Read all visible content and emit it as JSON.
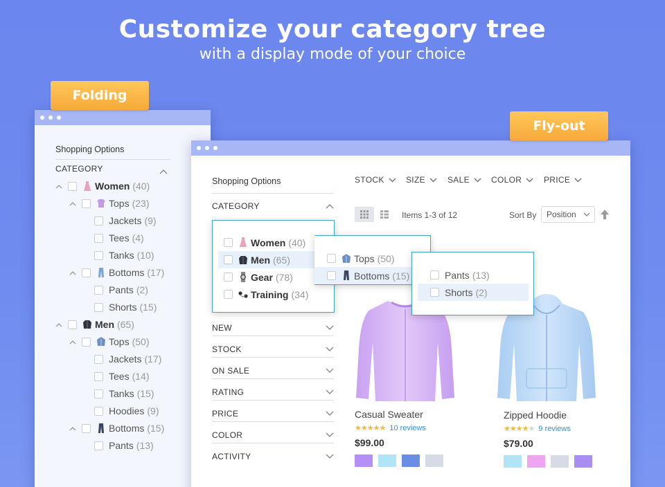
{
  "hero": {
    "title": "Customize your category tree",
    "subtitle": "with a display mode of your choice"
  },
  "badges": {
    "folding": "Folding",
    "flyout": "Fly-out"
  },
  "folding": {
    "header": "Shopping Options",
    "category_label": "CATEGORY",
    "tree": [
      {
        "label": "Women",
        "count": "(40)",
        "level": 0,
        "icon": "dress-icon",
        "bold": true
      },
      {
        "label": "Tops",
        "count": "(23)",
        "level": 1,
        "icon": "top-icon",
        "bold": false
      },
      {
        "label": "Jackets",
        "count": "(9)",
        "level": 2
      },
      {
        "label": "Tees",
        "count": "(4)",
        "level": 2
      },
      {
        "label": "Tanks",
        "count": "(10)",
        "level": 2
      },
      {
        "label": "Bottoms",
        "count": "(17)",
        "level": 1,
        "icon": "pants-icon"
      },
      {
        "label": "Pants",
        "count": "(2)",
        "level": 2
      },
      {
        "label": "Shorts",
        "count": "(15)",
        "level": 2
      },
      {
        "label": "Men",
        "count": "(65)",
        "level": 0,
        "icon": "jacket-icon",
        "bold": true
      },
      {
        "label": "Tops",
        "count": "(50)",
        "level": 1,
        "icon": "hoodie-icon"
      },
      {
        "label": "Jackets",
        "count": "(17)",
        "level": 2
      },
      {
        "label": "Tees",
        "count": "(14)",
        "level": 2
      },
      {
        "label": "Tanks",
        "count": "(15)",
        "level": 2
      },
      {
        "label": "Hoodies",
        "count": "(9)",
        "level": 2
      },
      {
        "label": "Bottoms",
        "count": "(15)",
        "level": 1,
        "icon": "pants-dark-icon"
      },
      {
        "label": "Pants",
        "count": "(13)",
        "level": 2
      }
    ]
  },
  "flyout": {
    "header": "Shopping Options",
    "category_label": "CATEGORY",
    "top_filters": [
      "STOCK",
      "SIZE",
      "SALE",
      "COLOR",
      "PRICE"
    ],
    "items_text": "Items 1-3 of 12",
    "sort_by_label": "Sort By",
    "sort_value": "Position",
    "level1": [
      {
        "label": "Women",
        "count": "(40)",
        "icon": "dress-icon"
      },
      {
        "label": "Men",
        "count": "(65)",
        "icon": "jacket-icon"
      },
      {
        "label": "Gear",
        "count": "(78)",
        "icon": "watch-icon"
      },
      {
        "label": "Training",
        "count": "(34)",
        "icon": "earbuds-icon"
      }
    ],
    "level2": [
      {
        "label": "Tops",
        "count": "(50)",
        "icon": "hoodie-icon"
      },
      {
        "label": "Bottoms",
        "count": "(15)",
        "icon": "pants-dark-icon"
      }
    ],
    "level3": [
      {
        "label": "Pants",
        "count": "(13)"
      },
      {
        "label": "Shorts",
        "count": "(2)"
      }
    ],
    "filters": [
      "NEW",
      "STOCK",
      "ON SALE",
      "RATING",
      "PRICE",
      "COLOR",
      "ACTIVITY"
    ]
  },
  "products": [
    {
      "name": "Casual Sweater",
      "rating": 5,
      "reviews": "10 reviews",
      "price": "$99.00",
      "swatches": [
        "#b48ff5",
        "#b2e4f8",
        "#6b8de2",
        "#d7dbe5"
      ]
    },
    {
      "name": "Zipped Hoodie",
      "rating": 4,
      "reviews": "9 reviews",
      "price": "$79.00",
      "swatches": [
        "#b2e4f8",
        "#efa6f0",
        "#d7dbe5",
        "#a88ef0"
      ]
    }
  ]
}
